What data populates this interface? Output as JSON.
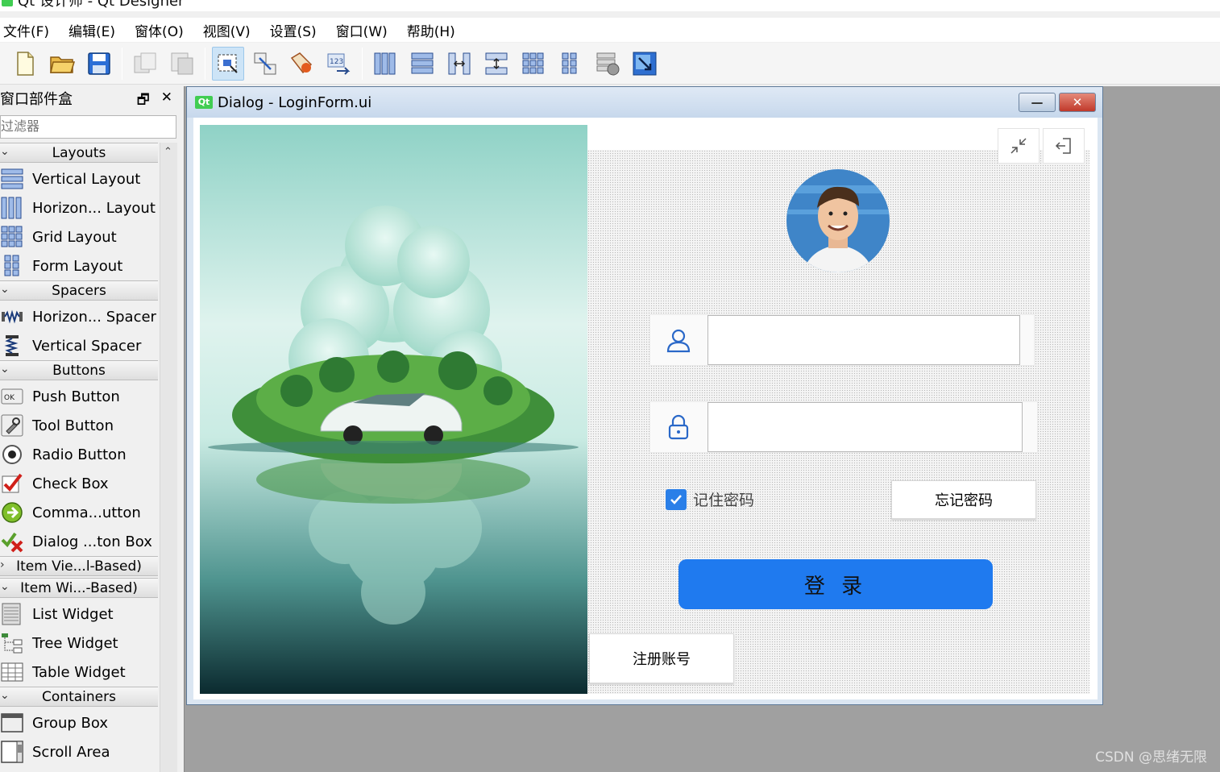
{
  "app": {
    "title": "Qt 设计师 - Qt Designer"
  },
  "menu": [
    {
      "label": "文件(F)"
    },
    {
      "label": "编辑(E)"
    },
    {
      "label": "窗体(O)"
    },
    {
      "label": "视图(V)"
    },
    {
      "label": "设置(S)"
    },
    {
      "label": "窗口(W)"
    },
    {
      "label": "帮助(H)"
    }
  ],
  "toolbar": {
    "icons": [
      "new-file-icon",
      "open-folder-icon",
      "save-icon",
      "copy-icon",
      "paste-icon",
      "edit-widgets-icon",
      "edit-signals-slots-icon",
      "edit-buddies-icon",
      "edit-tab-order-icon",
      "layout-horizontal-icon",
      "layout-vertical-icon",
      "layout-horizontal-splitter-icon",
      "layout-vertical-splitter-icon",
      "layout-grid-icon",
      "layout-form-icon",
      "break-layout-icon",
      "adjust-size-icon"
    ],
    "active": "edit-widgets-icon"
  },
  "widgetbox": {
    "title": "窗口部件盒",
    "filter_placeholder": "过滤器",
    "categories": {
      "layouts": "Layouts",
      "spacers": "Spacers",
      "buttons": "Buttons",
      "item_views": "Item Vie...l-Based)",
      "item_widgets": "Item Wi...-Based)",
      "containers": "Containers"
    },
    "items": {
      "vertical_layout": "Vertical Layout",
      "horizontal_layout": "Horizon... Layout",
      "grid_layout": "Grid Layout",
      "form_layout": "Form Layout",
      "horizontal_spacer": "Horizon... Spacer",
      "vertical_spacer": "Vertical Spacer",
      "push_button": "Push Button",
      "tool_button": "Tool Button",
      "radio_button": "Radio Button",
      "check_box": "Check Box",
      "command_link": "Comma...utton",
      "dialog_button_box": "Dialog ...ton Box",
      "list_widget": "List Widget",
      "tree_widget": "Tree Widget",
      "table_widget": "Table Widget",
      "group_box": "Group Box",
      "scroll_area": "Scroll Area"
    }
  },
  "dialog": {
    "title": "Dialog - LoginForm.ui",
    "badge": "Qt",
    "username_value": "",
    "password_value": "",
    "remember_label": "记住密码",
    "remember_checked": true,
    "forgot_label": "忘记密码",
    "login_label": "登 录",
    "register_label": "注册账号",
    "accent": "#1f7aef"
  },
  "watermark": "CSDN @思绪无限"
}
